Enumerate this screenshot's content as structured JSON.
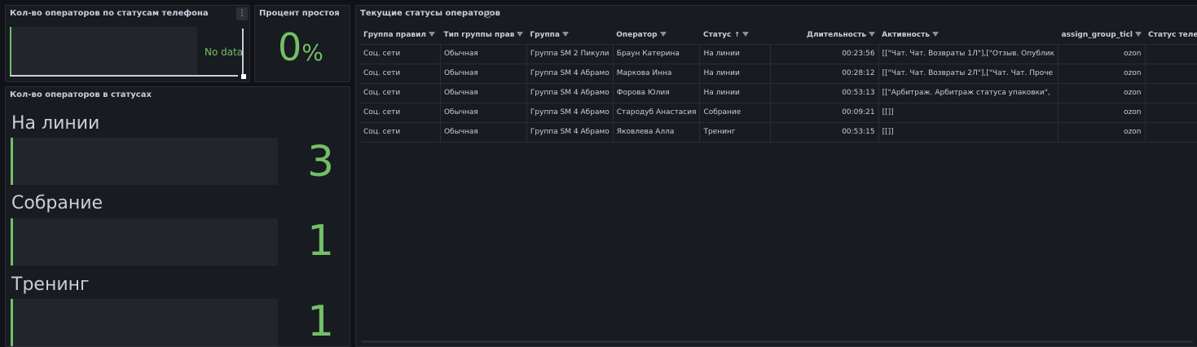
{
  "panel_phone_status": {
    "title": "Кол-во операторов по статусам телефона",
    "no_data": "No data",
    "menu_icon": "kebab-icon"
  },
  "panel_idle": {
    "title": "Процент простоя",
    "value": "0",
    "unit": "%"
  },
  "panel_status_counts": {
    "title": "Кол-во операторов в статусах",
    "items": [
      {
        "label": "На линии",
        "value": "3"
      },
      {
        "label": "Собрание",
        "value": "1"
      },
      {
        "label": "Тренинг",
        "value": "1"
      }
    ]
  },
  "panel_table": {
    "title": "Текущие статусы операторов",
    "info_icon": "info-icon",
    "columns": [
      "Группа правил",
      "Тип группы прав",
      "Группа",
      "Оператор",
      "Статус",
      "Длительность",
      "Активность",
      "assign_group_ticl",
      "Статус теле"
    ],
    "sort_indicator": "↑",
    "rows": [
      [
        "Соц. сети",
        "Обычная",
        "Группа SM 2 Пикули",
        "Браун Катерина",
        "На линии",
        "00:23:56",
        "[[\"Чат. Чат. Возвраты 1Л\"],[\"Отзыв. Опублик",
        "ozon",
        ""
      ],
      [
        "Соц. сети",
        "Обычная",
        "Группа SM 4 Абрамо",
        "Маркова Инна",
        "На линии",
        "00:28:12",
        "[[\"Чат. Чат. Возвраты 2Л\"],[\"Чат. Чат. Проче",
        "ozon",
        ""
      ],
      [
        "Соц. сети",
        "Обычная",
        "Группа SM 4 Абрамо",
        "Форова Юлия",
        "На линии",
        "00:53:13",
        "[[\"Арбитраж. Арбитраж статуса упаковки\",",
        "ozon",
        ""
      ],
      [
        "Соц. сети",
        "Обычная",
        "Группа SM 4 Абрамо",
        "Стародуб Анастасия",
        "Собрание",
        "00:09:21",
        "[[]]",
        "ozon",
        ""
      ],
      [
        "Соц. сети",
        "Обычная",
        "Группа SM 4 Абрамо",
        "Яковлева Алла",
        "Тренинг",
        "00:53:15",
        "[[]]",
        "ozon",
        ""
      ]
    ]
  },
  "colors": {
    "accent_green": "#73bf69",
    "panel_bg": "#181b1f",
    "page_bg": "#111217"
  }
}
